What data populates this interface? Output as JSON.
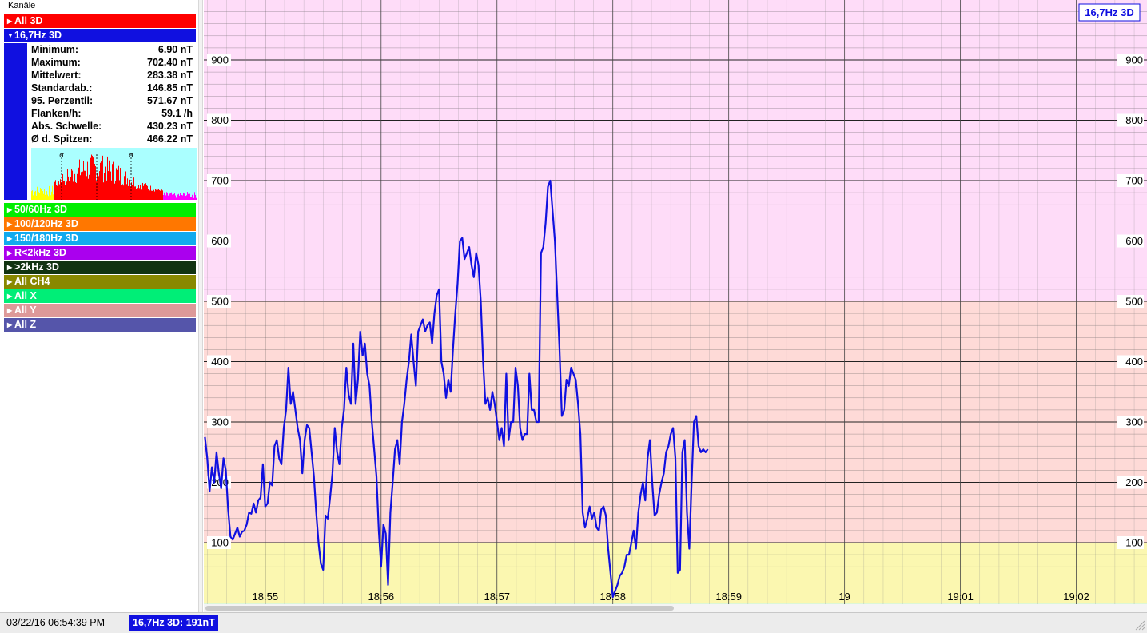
{
  "sidebar": {
    "title": "Kanäle",
    "channels_top": [
      {
        "label": "All 3D",
        "color": "#ff0000",
        "expanded": false
      },
      {
        "label": "16,7Hz 3D",
        "color": "#1010e0",
        "expanded": true
      }
    ],
    "channels_bottom": [
      {
        "label": "50/60Hz 3D",
        "color": "#00ee00"
      },
      {
        "label": "100/120Hz 3D",
        "color": "#ff7700"
      },
      {
        "label": "150/180Hz 3D",
        "color": "#11aaee"
      },
      {
        "label": "R<2kHz 3D",
        "color": "#aa00ee"
      },
      {
        "label": ">2kHz 3D",
        "color": "#113311"
      },
      {
        "label": "All CH4",
        "color": "#888800"
      },
      {
        "label": "All X",
        "color": "#00ee77"
      },
      {
        "label": "All Y",
        "color": "#dd9999"
      },
      {
        "label": "All Z",
        "color": "#5555aa"
      }
    ],
    "stats": [
      {
        "label": "Minimum:",
        "value": "6.90 nT"
      },
      {
        "label": "Maximum:",
        "value": "702.40 nT"
      },
      {
        "label": "Mittelwert:",
        "value": "283.38 nT"
      },
      {
        "label": "Standardab.:",
        "value": "146.85 nT"
      },
      {
        "label": "95. Perzentil:",
        "value": "571.67 nT"
      },
      {
        "label": "Flanken/h:",
        "value": "59.1 /h"
      },
      {
        "label": "Abs. Schwelle:",
        "value": "430.23 nT"
      },
      {
        "label": "Ø d. Spitzen:",
        "value": "466.22 nT"
      }
    ],
    "histogram_markers": [
      "σ",
      "·",
      "σ"
    ]
  },
  "chart": {
    "badge": "16,7Hz 3D",
    "bands": [
      {
        "from": 0,
        "to": 100,
        "color": "#fbf7b0"
      },
      {
        "from": 100,
        "to": 500,
        "color": "#fedad7"
      },
      {
        "from": 500,
        "to": 1000,
        "color": "#fedcf8"
      }
    ],
    "line_color": "#1010e0"
  },
  "chart_data": {
    "type": "line",
    "title": "",
    "xlabel": "",
    "ylabel": "",
    "y_tick_labels": [
      "100",
      "200",
      "300",
      "400",
      "500",
      "600",
      "700",
      "800",
      "900"
    ],
    "x_tick_labels": [
      "18:55",
      "18:56",
      "18:57",
      "18:58",
      "18:59",
      "19",
      "19:01",
      "19:02"
    ],
    "x_tick_minutes": [
      0,
      1,
      2,
      3,
      4,
      5,
      6,
      7
    ],
    "xlim_minutes": [
      -0.53,
      7.61
    ],
    "ylim": [
      0,
      1000
    ],
    "series": [
      {
        "name": "16,7Hz 3D",
        "unit": "nT",
        "x_minutes": [
          -0.52,
          -0.5,
          -0.48,
          -0.46,
          -0.44,
          -0.42,
          -0.4,
          -0.38,
          -0.36,
          -0.34,
          -0.32,
          -0.3,
          -0.28,
          -0.26,
          -0.24,
          -0.22,
          -0.2,
          -0.18,
          -0.16,
          -0.14,
          -0.12,
          -0.1,
          -0.08,
          -0.06,
          -0.04,
          -0.02,
          0,
          0.02,
          0.04,
          0.06,
          0.08,
          0.1,
          0.12,
          0.14,
          0.16,
          0.18,
          0.2,
          0.22,
          0.24,
          0.26,
          0.28,
          0.3,
          0.32,
          0.34,
          0.36,
          0.38,
          0.4,
          0.42,
          0.44,
          0.46,
          0.48,
          0.5,
          0.52,
          0.54,
          0.56,
          0.58,
          0.6,
          0.62,
          0.64,
          0.66,
          0.68,
          0.7,
          0.72,
          0.74,
          0.76,
          0.78,
          0.8,
          0.82,
          0.84,
          0.86,
          0.88,
          0.9,
          0.92,
          0.94,
          0.96,
          0.98,
          1,
          1.02,
          1.04,
          1.06,
          1.08,
          1.1,
          1.12,
          1.14,
          1.16,
          1.18,
          1.2,
          1.22,
          1.24,
          1.26,
          1.28,
          1.3,
          1.32,
          1.34,
          1.36,
          1.38,
          1.4,
          1.42,
          1.44,
          1.46,
          1.48,
          1.5,
          1.52,
          1.54,
          1.56,
          1.58,
          1.6,
          1.62,
          1.64,
          1.66,
          1.68,
          1.7,
          1.72,
          1.74,
          1.76,
          1.78,
          1.8,
          1.82,
          1.84,
          1.86,
          1.88,
          1.9,
          1.92,
          1.94,
          1.96,
          1.98,
          2,
          2.02,
          2.04,
          2.06,
          2.08,
          2.1,
          2.12,
          2.14,
          2.16,
          2.18,
          2.2,
          2.22,
          2.24,
          2.26,
          2.28,
          2.3,
          2.32,
          2.34,
          2.36,
          2.38,
          2.4,
          2.42,
          2.44,
          2.46,
          2.48,
          2.5,
          2.52,
          2.54,
          2.56,
          2.58,
          2.6,
          2.62,
          2.64,
          2.66,
          2.68,
          2.7,
          2.72,
          2.74,
          2.76,
          2.78,
          2.8,
          2.82,
          2.84,
          2.86,
          2.88,
          2.9,
          2.92,
          2.94,
          2.96,
          2.98,
          3,
          3.02,
          3.04,
          3.06,
          3.08,
          3.1,
          3.12,
          3.14,
          3.16,
          3.18,
          3.2,
          3.22,
          3.24,
          3.26,
          3.28,
          3.3,
          3.32,
          3.34,
          3.36,
          3.38,
          3.4,
          3.42,
          3.44,
          3.46,
          3.48,
          3.5,
          3.52,
          3.54,
          3.56,
          3.58,
          3.6,
          3.62,
          3.64,
          3.66,
          3.68,
          3.7,
          3.72,
          3.74,
          3.76,
          3.78,
          3.8,
          3.82,
          3.84,
          3.86,
          3.88,
          3.9,
          3.92,
          3.94,
          3.96,
          3.98,
          4,
          4.02,
          4.04,
          4.06,
          4.08,
          4.1,
          4.12,
          4.14,
          4.16,
          4.18,
          4.2,
          4.22,
          4.24,
          4.26,
          4.28,
          4.3,
          4.32,
          4.34,
          4.36,
          4.38,
          4.4,
          4.42,
          4.44,
          4.46,
          4.48,
          4.5,
          4.52,
          4.54,
          4.56,
          4.58,
          4.6,
          4.62,
          4.64,
          4.66,
          4.68,
          4.7,
          4.72,
          4.74,
          4.76,
          4.78,
          4.8,
          4.82,
          4.84,
          4.86,
          4.88,
          4.9,
          4.92,
          4.94,
          4.96,
          4.98,
          5,
          5.02,
          5.04,
          5.06,
          5.08,
          5.1,
          5.12,
          5.14,
          5.16,
          5.18,
          5.2,
          5.22,
          5.24,
          5.26,
          5.28,
          5.3,
          5.32,
          5.34,
          5.36,
          5.38,
          5.4,
          5.42,
          5.44,
          5.46,
          5.48,
          5.5,
          5.52,
          5.54,
          5.56,
          5.58,
          5.6,
          5.62,
          5.64,
          5.66,
          5.68,
          5.7,
          5.72,
          5.74,
          5.76,
          5.78,
          5.8,
          5.82,
          5.84,
          5.86,
          5.88,
          5.9,
          5.92,
          5.94,
          5.96,
          5.98,
          6,
          6.02,
          6.04,
          6.06,
          6.08,
          6.1,
          6.12,
          6.14,
          6.16,
          6.18,
          6.2,
          6.22,
          6.24,
          6.26,
          6.28,
          6.3,
          6.32,
          6.34,
          6.36,
          6.38,
          6.4,
          6.42,
          6.44,
          6.46,
          6.48,
          6.5,
          6.52,
          6.54,
          6.56,
          6.58,
          6.6,
          6.62,
          6.64,
          6.66,
          6.68,
          6.7,
          6.72,
          6.74,
          6.76,
          6.78,
          6.8,
          6.82,
          6.84,
          6.86,
          6.88,
          6.9,
          6.92,
          6.94,
          6.96,
          6.98,
          7,
          7.02,
          7.04,
          7.06,
          7.08,
          7.1,
          7.12,
          7.14,
          7.16,
          7.18,
          7.2,
          7.22,
          7.24,
          7.26,
          7.28,
          7.3,
          7.32,
          7.34,
          7.36,
          7.38,
          7.4,
          7.42,
          7.44,
          7.46,
          7.48,
          7.5,
          7.52,
          7.54,
          7.56,
          7.58,
          7.6
        ],
        "values": [
          275,
          240,
          185,
          225,
          200,
          250,
          215,
          190,
          240,
          220,
          155,
          110,
          105,
          115,
          125,
          110,
          118,
          120,
          130,
          150,
          148,
          165,
          150,
          170,
          175,
          230,
          160,
          165,
          200,
          195,
          260,
          270,
          240,
          230,
          290,
          320,
          390,
          330,
          350,
          320,
          290,
          270,
          215,
          270,
          295,
          290,
          250,
          210,
          150,
          100,
          65,
          55,
          145,
          140,
          175,
          215,
          290,
          250,
          230,
          290,
          320,
          390,
          345,
          330,
          430,
          330,
          370,
          450,
          410,
          430,
          380,
          360,
          300,
          255,
          210,
          120,
          60,
          130,
          115,
          30,
          150,
          200,
          255,
          270,
          230,
          300,
          330,
          370,
          400,
          445,
          400,
          360,
          450,
          460,
          470,
          450,
          460,
          465,
          430,
          480,
          510,
          520,
          400,
          380,
          340,
          370,
          350,
          420,
          480,
          530,
          600,
          605,
          570,
          580,
          590,
          560,
          540,
          580,
          560,
          500,
          400,
          330,
          340,
          320,
          350,
          330,
          300,
          270,
          290,
          260,
          380,
          270,
          300,
          300,
          390,
          360,
          290,
          270,
          280,
          280,
          380,
          320,
          320,
          300,
          300,
          580,
          590,
          630,
          690,
          700,
          650,
          600,
          510,
          420,
          310,
          320,
          370,
          360,
          390,
          380,
          370,
          330,
          280,
          150,
          125,
          140,
          160,
          140,
          150,
          125,
          120,
          155,
          160,
          145,
          90,
          50,
          10,
          20,
          30,
          45,
          50,
          60,
          80,
          80,
          100,
          120,
          90,
          150,
          180,
          200,
          170,
          240,
          270,
          200,
          145,
          150,
          180,
          200,
          215,
          250,
          260,
          280,
          290,
          240,
          50,
          55,
          250,
          270,
          150,
          90,
          200,
          300,
          310,
          260,
          250,
          255,
          250,
          255
        ],
        "x_minutes_note": ""
      }
    ]
  },
  "status": {
    "timestamp": "03/22/16 06:54:39 PM",
    "reading": "16,7Hz 3D: 191nT"
  }
}
